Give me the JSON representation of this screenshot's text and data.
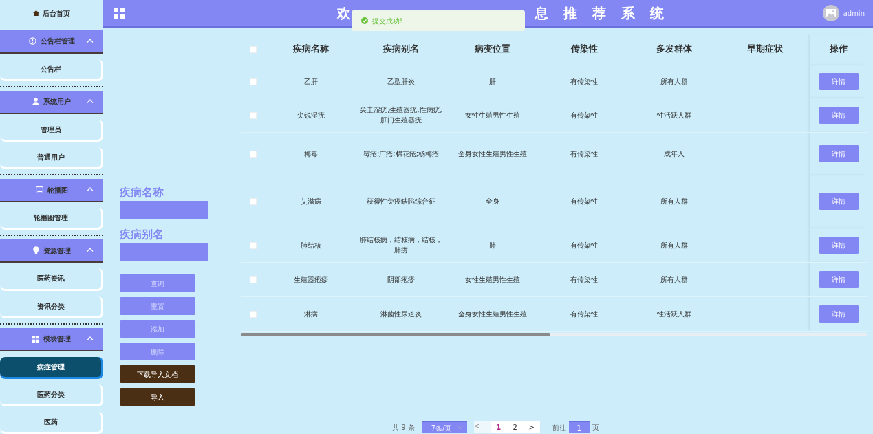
{
  "sidebar": {
    "home": {
      "label": "后台首页"
    },
    "groups": [
      {
        "label": "公告栏管理",
        "expanded": true,
        "items": [
          {
            "label": "公告栏",
            "selected": false
          }
        ]
      },
      {
        "label": "系统用户",
        "expanded": true,
        "items": [
          {
            "label": "管理员",
            "selected": false
          },
          {
            "label": "普通用户",
            "selected": false
          }
        ]
      },
      {
        "label": "轮播图",
        "expanded": true,
        "items": [
          {
            "label": "轮播图管理",
            "selected": false
          }
        ]
      },
      {
        "label": "资源管理",
        "expanded": true,
        "items": [
          {
            "label": "医药资讯",
            "selected": false
          },
          {
            "label": "资讯分类",
            "selected": false
          }
        ]
      },
      {
        "label": "模块管理",
        "expanded": true,
        "items": [
          {
            "label": "病症管理",
            "selected": true
          },
          {
            "label": "医药分类",
            "selected": false
          },
          {
            "label": "医药",
            "selected": false
          }
        ]
      }
    ]
  },
  "topbar": {
    "title_parts": [
      "欢",
      "息 推 荐 系 统"
    ],
    "user": "admin"
  },
  "toast": {
    "message": "提交成功!"
  },
  "search": {
    "fields": [
      {
        "label": "疾病名称"
      },
      {
        "label": "疾病别名"
      }
    ],
    "buttons": [
      {
        "label": "查询",
        "kind": "light"
      },
      {
        "label": "重置",
        "kind": "light"
      },
      {
        "label": "添加",
        "kind": "light"
      },
      {
        "label": "删除",
        "kind": "light"
      },
      {
        "label": "下载导入文档",
        "kind": "dark"
      },
      {
        "label": "导入",
        "kind": "dark"
      }
    ]
  },
  "table": {
    "all_checked": false,
    "columns": [
      "疾病名称",
      "疾病别名",
      "病变位置",
      "传染性",
      "多发群体",
      "早期症状",
      "操作"
    ],
    "rows": [
      {
        "checked": false,
        "cells": [
          "乙肝",
          "乙型肝炎",
          "肝",
          "有传染性",
          "所有人群",
          ""
        ],
        "action": "详情"
      },
      {
        "checked": false,
        "cells": [
          "尖锐湿疣",
          "尖圭湿疣,生殖器疣,性病疣,肛门生殖器疣",
          "女性生殖男性生殖",
          "有传染性",
          "性活跃人群",
          ""
        ],
        "action": "详情"
      },
      {
        "checked": false,
        "cells": [
          "梅毒",
          "霉疮;广疮;棉花疮;杨梅疮",
          "全身女性生殖男性生殖",
          "有传染性",
          "成年人",
          ""
        ],
        "action": "详情"
      },
      {
        "checked": false,
        "cells": [
          "艾滋病",
          "获得性免疫缺陷综合征",
          "全身",
          "有传染性",
          "所有人群",
          ""
        ],
        "action": "详情"
      },
      {
        "checked": false,
        "cells": [
          "肺结核",
          "肺结核病，结核病，结核，肺痨",
          "肺",
          "有传染性",
          "所有人群",
          ""
        ],
        "action": "详情"
      },
      {
        "checked": false,
        "cells": [
          "生殖器疱疹",
          "阴部疱疹",
          "女性生殖男性生殖",
          "有传染性",
          "所有人群",
          ""
        ],
        "action": "详情"
      },
      {
        "checked": false,
        "cells": [
          "淋病",
          "淋菌性尿道炎",
          "全身女性生殖男性生殖",
          "有传染性",
          "性活跃人群",
          ""
        ],
        "action": "详情"
      }
    ]
  },
  "pagination": {
    "total": "共 9 条",
    "page_size": "7条/页",
    "prev": "<",
    "pages": [
      {
        "label": "1",
        "selected": true
      },
      {
        "label": "2",
        "selected": false
      }
    ],
    "next": ">",
    "goto_label": "前往",
    "goto_value": "1",
    "goto_suffix": "页"
  }
}
